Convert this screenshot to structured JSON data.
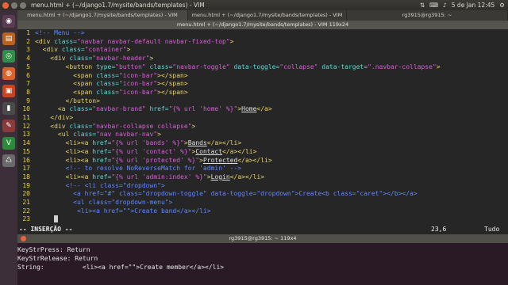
{
  "top_panel": {
    "title": "menu.html + (~/django1.7/mysite/bands/templates) - VIM",
    "clock": "5 de Jan 12:45",
    "tray_icons": [
      "network-icon",
      "keyboard-icon",
      "volume-icon",
      "gear-icon"
    ]
  },
  "tabs": [
    "menu.html + (~/django1.7/mysite/bands/templates) - VIM",
    "menu.html + (~/django1.7/mysite/bands/templates) - VIM",
    "rg3915@rg3915: ~"
  ],
  "vim_title": "menu.html + (~/django1.7/mysite/bands/templates) - VIM 119x24",
  "editor": {
    "lines": [
      {
        "n": "1",
        "segs": [
          [
            "comment",
            "<!-- Menu -->"
          ]
        ]
      },
      {
        "n": "2",
        "segs": [
          [
            "tag",
            "<div "
          ],
          [
            "attr",
            "class="
          ],
          [
            "str",
            "\"navbar navbar-default navbar-fixed-top\""
          ],
          [
            "tag",
            ">"
          ]
        ]
      },
      {
        "n": "3",
        "segs": [
          [
            "text",
            "  "
          ],
          [
            "tag",
            "<div "
          ],
          [
            "attr",
            "class="
          ],
          [
            "str",
            "\"container\""
          ],
          [
            "tag",
            ">"
          ]
        ]
      },
      {
        "n": "4",
        "segs": [
          [
            "text",
            "    "
          ],
          [
            "tag",
            "<div "
          ],
          [
            "attr",
            "class="
          ],
          [
            "str",
            "\"navbar-header\""
          ],
          [
            "tag",
            ">"
          ]
        ]
      },
      {
        "n": "5",
        "segs": [
          [
            "text",
            "        "
          ],
          [
            "tag",
            "<button "
          ],
          [
            "attr",
            "type="
          ],
          [
            "str",
            "\"button\" "
          ],
          [
            "attr",
            "class="
          ],
          [
            "str",
            "\"navbar-toggle\" "
          ],
          [
            "attr",
            "data-toggle="
          ],
          [
            "str",
            "\"collapse\" "
          ],
          [
            "attr",
            "data-target="
          ],
          [
            "str",
            "\".navbar-collapse\""
          ],
          [
            "tag",
            ">"
          ]
        ]
      },
      {
        "n": "6",
        "segs": [
          [
            "text",
            "          "
          ],
          [
            "tag",
            "<span "
          ],
          [
            "attr",
            "class="
          ],
          [
            "str",
            "\"icon-bar\""
          ],
          [
            "tag",
            "></span>"
          ]
        ]
      },
      {
        "n": "7",
        "segs": [
          [
            "text",
            "          "
          ],
          [
            "tag",
            "<span "
          ],
          [
            "attr",
            "class="
          ],
          [
            "str",
            "\"icon-bar\""
          ],
          [
            "tag",
            "></span>"
          ]
        ]
      },
      {
        "n": "8",
        "segs": [
          [
            "text",
            "          "
          ],
          [
            "tag",
            "<span "
          ],
          [
            "attr",
            "class="
          ],
          [
            "str",
            "\"icon-bar\""
          ],
          [
            "tag",
            "></span>"
          ]
        ]
      },
      {
        "n": "9",
        "segs": [
          [
            "text",
            "        "
          ],
          [
            "tag",
            "</button>"
          ]
        ]
      },
      {
        "n": "10",
        "segs": [
          [
            "text",
            "      "
          ],
          [
            "tag",
            "<a "
          ],
          [
            "attr",
            "class="
          ],
          [
            "str",
            "\"navbar-brand\" "
          ],
          [
            "attr",
            "href="
          ],
          [
            "str",
            "\"{% url 'home' %}\""
          ],
          [
            "tag",
            ">"
          ],
          [
            "ul",
            "Home"
          ],
          [
            "tag",
            "</a>"
          ]
        ]
      },
      {
        "n": "11",
        "segs": [
          [
            "text",
            "    "
          ],
          [
            "tag",
            "</div>"
          ]
        ]
      },
      {
        "n": "12",
        "segs": [
          [
            "text",
            "    "
          ],
          [
            "tag",
            "<div "
          ],
          [
            "attr",
            "class="
          ],
          [
            "str",
            "\"navbar-collapse collapse\""
          ],
          [
            "tag",
            ">"
          ]
        ]
      },
      {
        "n": "13",
        "segs": [
          [
            "text",
            "      "
          ],
          [
            "tag",
            "<ul "
          ],
          [
            "attr",
            "class="
          ],
          [
            "str",
            "\"nav navbar-nav\""
          ],
          [
            "tag",
            ">"
          ]
        ]
      },
      {
        "n": "14",
        "segs": [
          [
            "text",
            "        "
          ],
          [
            "tag",
            "<li><a "
          ],
          [
            "attr",
            "href="
          ],
          [
            "str",
            "\"{% url 'bands' %}\""
          ],
          [
            "tag",
            ">"
          ],
          [
            "ul",
            "Bands"
          ],
          [
            "tag",
            "</a></li>"
          ]
        ]
      },
      {
        "n": "15",
        "segs": [
          [
            "text",
            "        "
          ],
          [
            "tag",
            "<li><a "
          ],
          [
            "attr",
            "href="
          ],
          [
            "str",
            "\"{% url 'contact' %}\""
          ],
          [
            "tag",
            ">"
          ],
          [
            "ul",
            "Contact"
          ],
          [
            "tag",
            "</a></li>"
          ]
        ]
      },
      {
        "n": "16",
        "segs": [
          [
            "text",
            "        "
          ],
          [
            "tag",
            "<li><a "
          ],
          [
            "attr",
            "href="
          ],
          [
            "str",
            "\"{% url 'protected' %}\""
          ],
          [
            "tag",
            ">"
          ],
          [
            "ul",
            "Protected"
          ],
          [
            "tag",
            "</a></li>"
          ]
        ]
      },
      {
        "n": "17",
        "segs": [
          [
            "text",
            "        "
          ],
          [
            "comment",
            "<!-- to resolve NoReverseMatch for 'admin' -->"
          ]
        ]
      },
      {
        "n": "18",
        "segs": [
          [
            "text",
            "        "
          ],
          [
            "tag",
            "<li><a "
          ],
          [
            "attr",
            "href="
          ],
          [
            "str",
            "\"{% url 'admin:index' %}\""
          ],
          [
            "tag",
            ">"
          ],
          [
            "ul",
            "Login"
          ],
          [
            "tag",
            "</a></li>"
          ]
        ]
      },
      {
        "n": "19",
        "segs": [
          [
            "text",
            "        "
          ],
          [
            "comment",
            "<!-- <li class=\"dropdown\">"
          ]
        ]
      },
      {
        "n": "20",
        "segs": [
          [
            "text",
            "          "
          ],
          [
            "comment",
            "<a href=\"#\" class=\"dropdown-toggle\" data-toggle=\"dropdown\">Create<b class=\"caret\"></b></a>"
          ]
        ]
      },
      {
        "n": "21",
        "segs": [
          [
            "text",
            "          "
          ],
          [
            "comment",
            "<ul class=\"dropdown-menu\">"
          ]
        ]
      },
      {
        "n": "22",
        "segs": [
          [
            "text",
            "           "
          ],
          [
            "comment",
            "<li><a href=\"\">Create band</a></li>"
          ]
        ]
      },
      {
        "n": "23",
        "segs": [
          [
            "text",
            "  "
          ]
        ]
      }
    ],
    "mode": "-- INSERÇÃO --",
    "position": "23,6",
    "scroll": "Tudo"
  },
  "terminal": {
    "title": "rg3915@rg3915: ~ 119x4",
    "lines": [
      "KeyStrPress: Return",
      "KeyStrRelease: Return",
      "String:          <li><a href=\"\">Create member</a></li>"
    ]
  },
  "launcher": [
    {
      "name": "dash-icon",
      "color": "#5a3c52"
    },
    {
      "name": "files-icon",
      "color": "#b8641f"
    },
    {
      "name": "chrome-icon",
      "color": "#2f8f46"
    },
    {
      "name": "firefox-icon",
      "color": "#d9632b"
    },
    {
      "name": "software-center-icon",
      "color": "#c94520"
    },
    {
      "name": "terminal-icon",
      "color": "#4a4a4a"
    },
    {
      "name": "text-editor-icon",
      "color": "#8a3a3a"
    },
    {
      "name": "vim-icon",
      "color": "#2d8a3a"
    },
    {
      "name": "trash-icon",
      "color": "#6a6a6a"
    }
  ]
}
